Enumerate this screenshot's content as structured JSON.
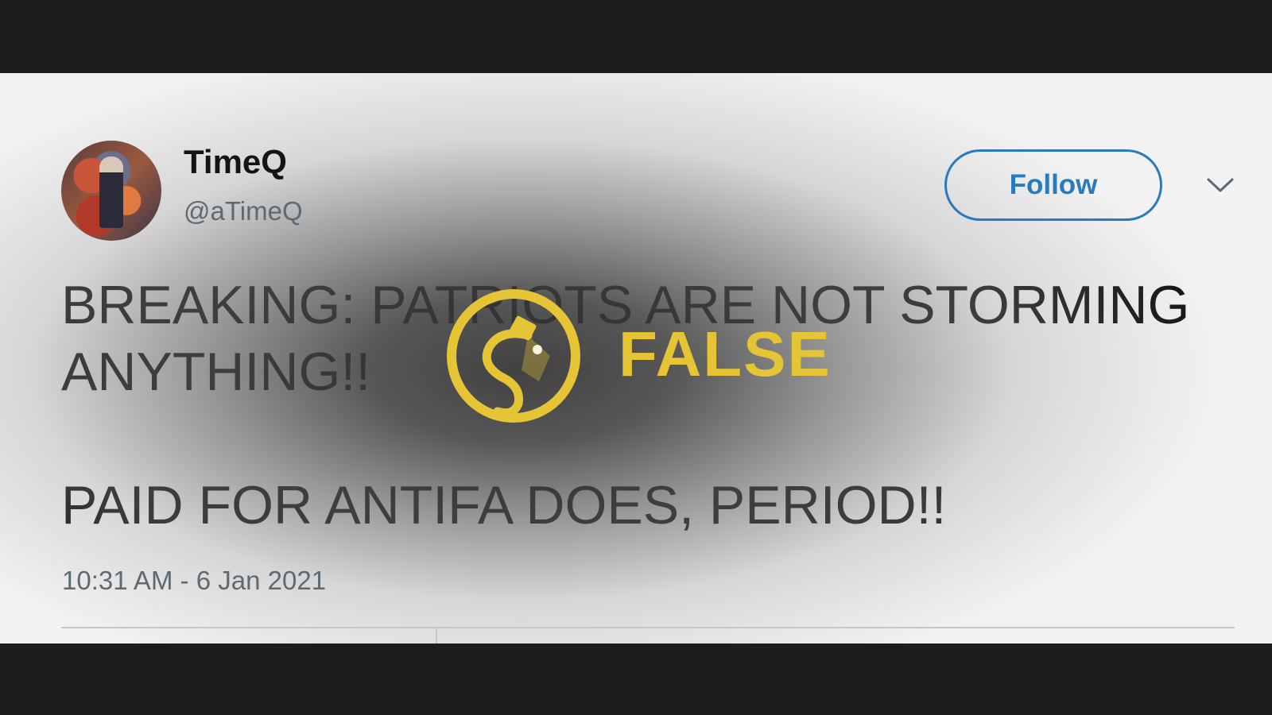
{
  "tweet": {
    "author": {
      "display_name": "TimeQ",
      "handle": "@aTimeQ"
    },
    "follow_label": "Follow",
    "text_lines": [
      "BREAKING: PATRIOTS ARE NOT STORMING",
      "ANYTHING!!",
      "",
      "PAID FOR ANTIFA DOES, PERIOD!!"
    ],
    "timestamp": "10:31 AM - 6 Jan 2021"
  },
  "verdict": {
    "label": "FALSE",
    "icon": "snopes-logo-icon",
    "color": "#e5c435"
  },
  "colors": {
    "follow_accent": "#2a7bbd",
    "text": "#141414",
    "muted": "#5d6a74",
    "frame": "#1d1d1f"
  }
}
